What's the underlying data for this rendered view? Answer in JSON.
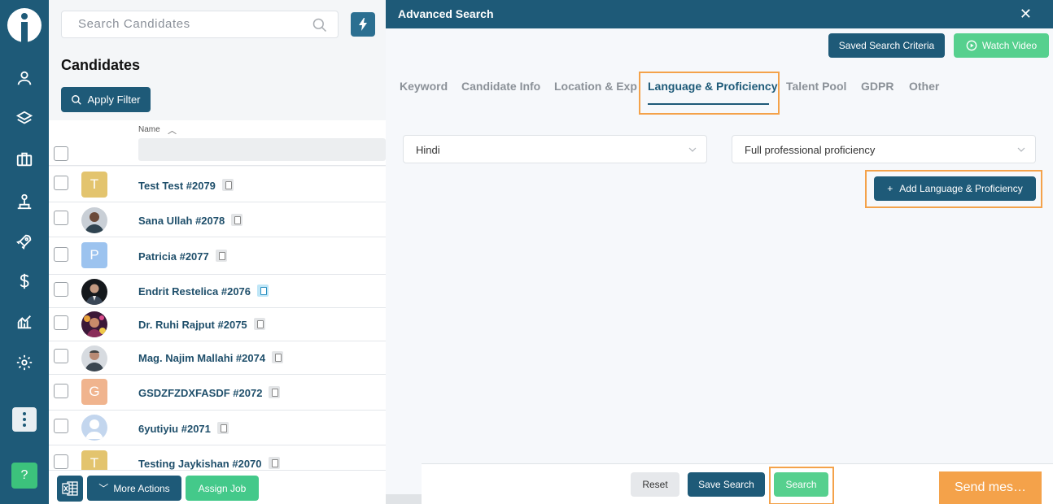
{
  "search": {
    "placeholder": "Search Candidates"
  },
  "candidates": {
    "title": "Candidates",
    "apply_filter_label": "Apply Filter",
    "name_column_label": "Name",
    "rows": [
      {
        "name": "Test Test #2079",
        "avatar_letter": "T",
        "avatar_color": "#e3c46e"
      },
      {
        "name": "Sana Ullah #2078",
        "avatar_letter": "",
        "avatar_color": "#4a4f55"
      },
      {
        "name": "Patricia #2077",
        "avatar_letter": "P",
        "avatar_color": "#9cc3ef"
      },
      {
        "name": "Endrit Restelica #2076",
        "avatar_letter": "",
        "avatar_color": "#22262b"
      },
      {
        "name": "Dr. Ruhi Rajput #2075",
        "avatar_letter": "",
        "avatar_color": "#6b2a5c"
      },
      {
        "name": "Mag. Najim Mallahi #2074",
        "avatar_letter": "",
        "avatar_color": "#5d6670"
      },
      {
        "name": "GSDZFZDXFASDF #2072",
        "avatar_letter": "G",
        "avatar_color": "#f0b48e"
      },
      {
        "name": "6yutiyiu #2071",
        "avatar_letter": "",
        "avatar_color": "#b7d0ee"
      },
      {
        "name": "Testing Jaykishan #2070",
        "avatar_letter": "T",
        "avatar_color": "#e3c46e"
      }
    ],
    "more_actions_label": "More Actions",
    "assign_job_label": "Assign Job"
  },
  "modal": {
    "title": "Advanced Search",
    "saved_search_label": "Saved Search Criteria",
    "watch_video_label": "Watch Video",
    "tabs": [
      "Keyword",
      "Candidate Info",
      "Location & Exp",
      "Language & Proficiency",
      "Talent Pool",
      "GDPR",
      "Other"
    ],
    "active_tab": "Language & Proficiency",
    "language_value": "Hindi",
    "proficiency_value": "Full professional proficiency",
    "add_language_label": "Add Language & Proficiency",
    "reset_label": "Reset",
    "save_search_label": "Save Search",
    "search_label": "Search"
  },
  "send_message_label": "Send mes…",
  "help_label": "?",
  "colors": {
    "primary": "#1e5a78",
    "green": "#56d08e",
    "highlight": "#f4a24a"
  }
}
